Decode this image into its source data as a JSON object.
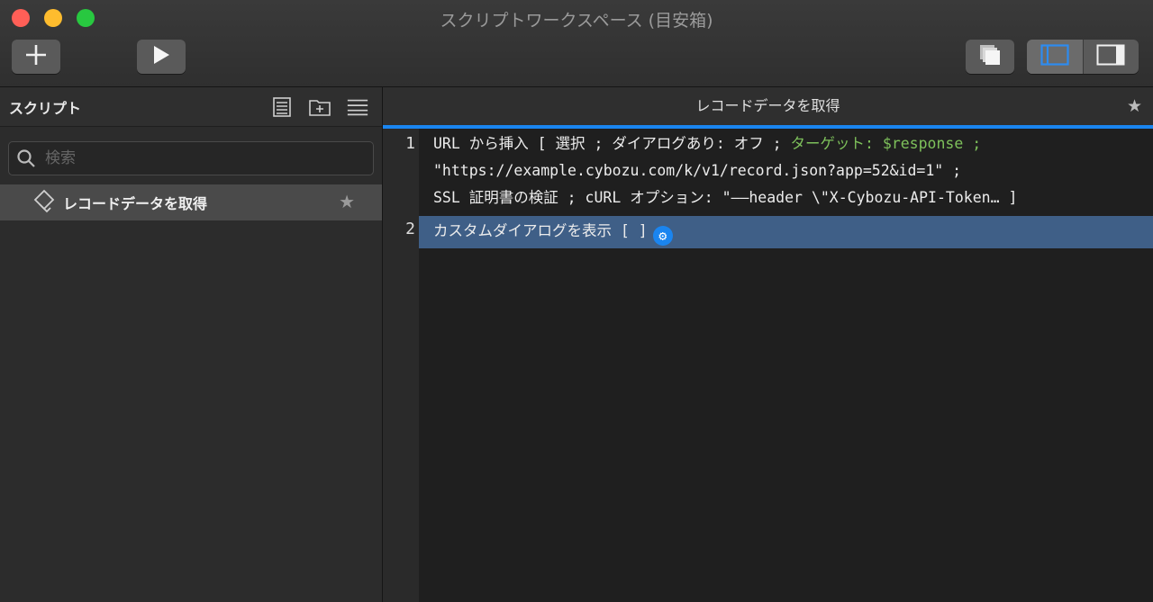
{
  "window": {
    "title": "スクリプトワークスペース (目安箱)"
  },
  "toolbar": {
    "add_icon": "plus-icon",
    "run_icon": "play-icon",
    "copy_icon": "stacked-pages-icon",
    "left_panel_icon": "sidebar-left-icon",
    "right_panel_icon": "sidebar-right-icon"
  },
  "sidebar": {
    "header_label": "スクリプト",
    "search_placeholder": "検索",
    "items": [
      {
        "label": "レコードデータを取得",
        "star": "★"
      }
    ]
  },
  "editor": {
    "tab_title": "レコードデータを取得",
    "tab_star": "★",
    "steps": [
      {
        "number": "1",
        "line1_a": "URL から挿入 [ 選択 ; ダイアログあり: オフ ; ",
        "line1_target": "ターゲット: $response ;",
        "line2": "\"https://example.cybozu.com/k/v1/record.json?app=52&id=1\" ;",
        "line3": "SSL 証明書の検証 ; cURL オプション: \"——header \\\"X-Cybozu-API-Token… ]"
      },
      {
        "number": "2",
        "text": "カスタムダイアログを表示 [ ]"
      }
    ]
  },
  "colors": {
    "accent": "#1a85f0",
    "selection": "#3f5f87",
    "target_green": "#7ec15b"
  }
}
